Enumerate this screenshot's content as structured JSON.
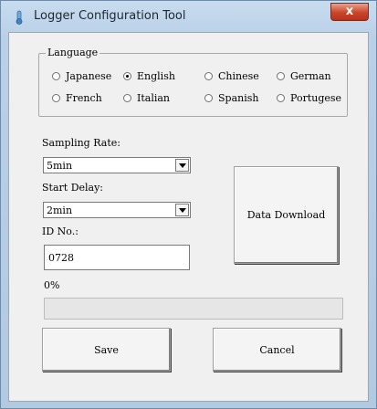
{
  "window": {
    "title": "Logger Configuration Tool",
    "close_label": "x"
  },
  "language": {
    "label": "Language",
    "options": [
      "Japanese",
      "English",
      "Chinese",
      "German",
      "French",
      "Italian",
      "Spanish",
      "Portugese"
    ],
    "selected": "English"
  },
  "sampling_rate": {
    "label": "Sampling Rate:",
    "value": "5min"
  },
  "start_delay": {
    "label": "Start Delay:",
    "value": "2min"
  },
  "id_no": {
    "label": "ID No.:",
    "value": "0728"
  },
  "progress": {
    "label": "0%",
    "fraction": 0
  },
  "buttons": {
    "data_download": "Data Download",
    "save": "Save",
    "cancel": "Cancel"
  }
}
